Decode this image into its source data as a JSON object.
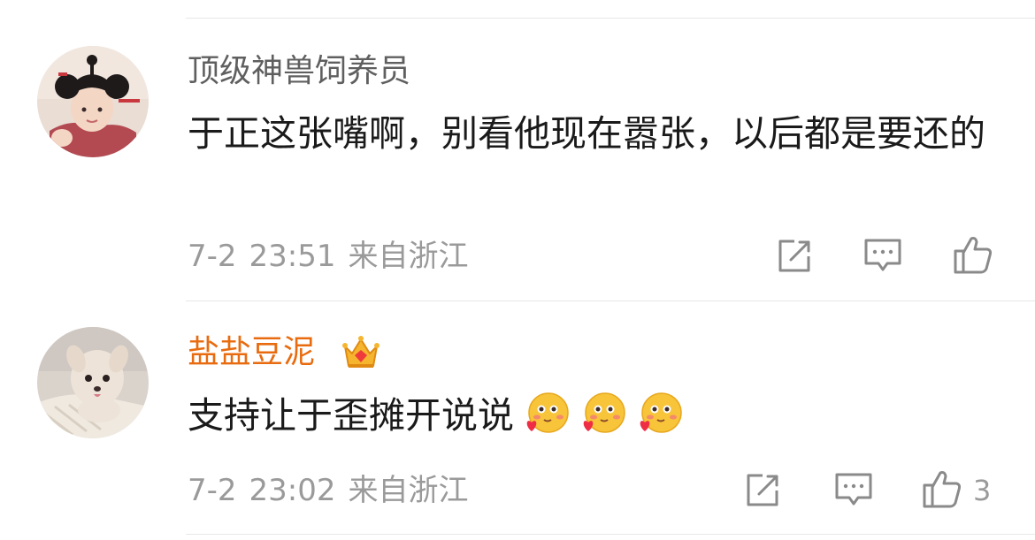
{
  "comments": [
    {
      "username": "顶级神兽饲养员",
      "vip": false,
      "content": "于正这张嘴啊，别看他现在嚣张，以后都是要还的",
      "date": "7-2",
      "time": "23:51",
      "location": "来自浙江",
      "like_count": ""
    },
    {
      "username": "盐盐豆泥",
      "vip": true,
      "content": "支持让于歪摊开说说",
      "emojis": [
        "blush-heart-emoji",
        "blush-heart-emoji",
        "blush-heart-emoji"
      ],
      "date": "7-2",
      "time": "23:02",
      "location": "来自浙江",
      "like_count": "3"
    }
  ],
  "icons": [
    "share-icon",
    "reply-icon",
    "like-icon",
    "crown-icon"
  ],
  "colors": {
    "username": "#5f5f5f",
    "vip_username": "#e86b0f",
    "text": "#1a1a1a",
    "meta": "#9a9a9a",
    "divider": "#e7e7e7"
  }
}
